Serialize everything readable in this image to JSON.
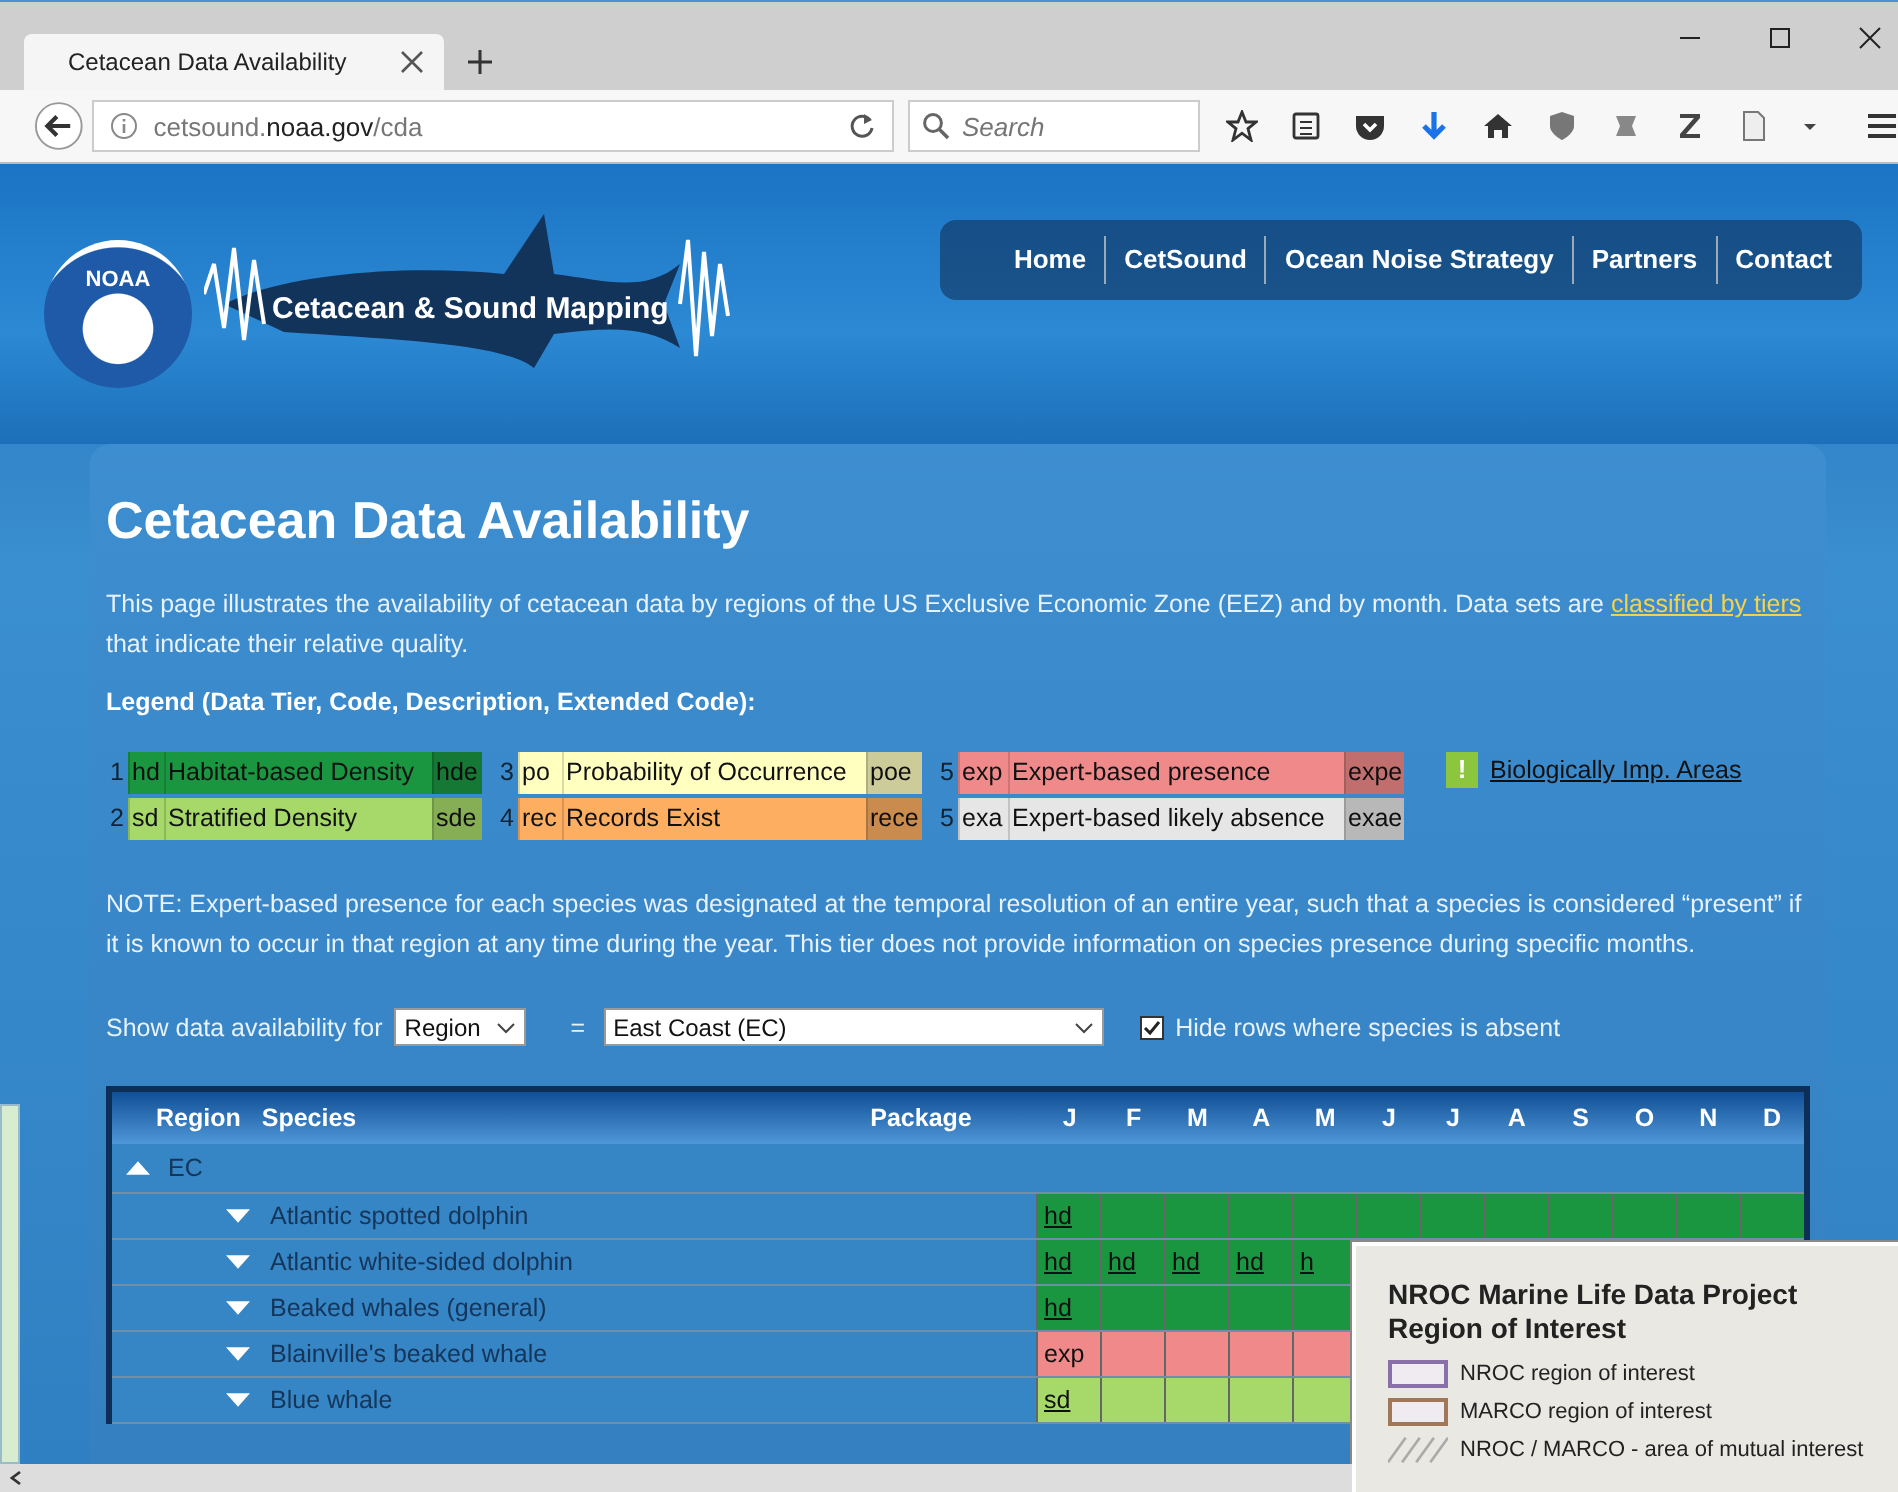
{
  "browser": {
    "tab": {
      "title": "Cetacean Data Availability",
      "selected": true
    },
    "address_bar": {
      "url": "cetsound.**noaa.gov**/cda"
    },
    "search": {
      "placeholder": "Search"
    }
  },
  "header": {
    "logo_text": "NOAA",
    "site_title": "Cetacean & Sound Mapping",
    "nav": [
      {
        "label": "Home"
      },
      {
        "label": "CetSound"
      },
      {
        "label": "Ocean Noise Strategy"
      },
      {
        "label": "Partners"
      },
      {
        "label": "Contact"
      }
    ]
  },
  "page": {
    "title": "Cetacean Data Availability",
    "intro": "This page illustrates the availability of cetacean data by regions of the US Exclusive Economic Zone (EEZ) and by month. Data sets are ",
    "intro_link": "classified by tiers",
    "intro_end": " that indicate their relative quality.",
    "legend": {
      "heading": "Legend (Data Tier, Code, Description, Extended Code):",
      "groups": [
        [
          {
            "tier": "1",
            "code": "hd",
            "description": "Habitat-based Density",
            "extended": "hde",
            "color": "#1a9641"
          },
          {
            "tier": "2",
            "code": "sd",
            "description": "Stratified Density",
            "extended": "sde",
            "color": "#a6d96a"
          }
        ],
        [
          {
            "tier": "3",
            "code": "po",
            "description": "Probability of Occurrence",
            "extended": "poe",
            "color": "#ffffc0"
          },
          {
            "tier": "4",
            "code": "rec",
            "description": "Records Exist",
            "extended": "rece",
            "color": "#fdae61"
          }
        ],
        [
          {
            "tier": "5",
            "code": "exp",
            "description": "Expert-based presence",
            "extended": "expe",
            "color": "#f08a8a"
          },
          {
            "tier": "5",
            "code": "exa",
            "description": "Expert-based likely absence",
            "extended": "exae",
            "color": "#e6e6e6"
          }
        ]
      ],
      "bia": {
        "icon": "!",
        "label": "Biologically Imp. Areas"
      }
    },
    "note": "NOTE: Expert-based presence for each species was designated at the temporal resolution of an entire year, such that a species is considered “present” if it is known to occur in that region at any time during the year. This tier does not provide information on species presence during specific months.",
    "controls": {
      "label": "Show data availability for",
      "group_by": {
        "value": "Region"
      },
      "equals": "=",
      "region": {
        "value": "East Coast (EC)"
      },
      "hide_absent": {
        "label": "Hide rows where species is absent",
        "checked": true
      }
    },
    "table": {
      "columns": [
        "Region",
        "Species",
        "Package"
      ],
      "months": [
        "J",
        "F",
        "M",
        "A",
        "M",
        "J",
        "J",
        "A",
        "S",
        "O",
        "N",
        "D"
      ],
      "groups": [
        {
          "name": "EC",
          "expanded": true,
          "rows": [
            {
              "species": "Atlantic spotted dolphin",
              "expanded": false,
              "color": "#1a9641",
              "linked": true,
              "cells": [
                "hd"
              ]
            },
            {
              "species": "Atlantic white-sided dolphin",
              "expanded": false,
              "color": "#1a9641",
              "linked": true,
              "cells": [
                "hd",
                "hd",
                "hd",
                "hd",
                "h"
              ]
            },
            {
              "species": "Beaked whales (general)",
              "expanded": false,
              "color": "#1a9641",
              "linked": true,
              "cells": [
                "hd"
              ]
            },
            {
              "species": "Blainville's beaked whale",
              "expanded": false,
              "color": "#f08a8a",
              "linked": false,
              "cells": [
                "exp"
              ]
            },
            {
              "species": "Blue whale",
              "expanded": false,
              "color": "#a6d96a",
              "linked": true,
              "cells": [
                "sd"
              ]
            }
          ]
        }
      ]
    }
  },
  "map_popup": {
    "title": "NROC Marine Life Data Project Region of Interest",
    "items": [
      {
        "label": "NROC region of interest",
        "kind": "swatch",
        "color": "#8a70a8"
      },
      {
        "label": "MARCO region of interest",
        "kind": "swatch",
        "color": "#a07858"
      },
      {
        "label": "NROC / MARCO - area of mutual interest",
        "kind": "hatch"
      }
    ]
  }
}
